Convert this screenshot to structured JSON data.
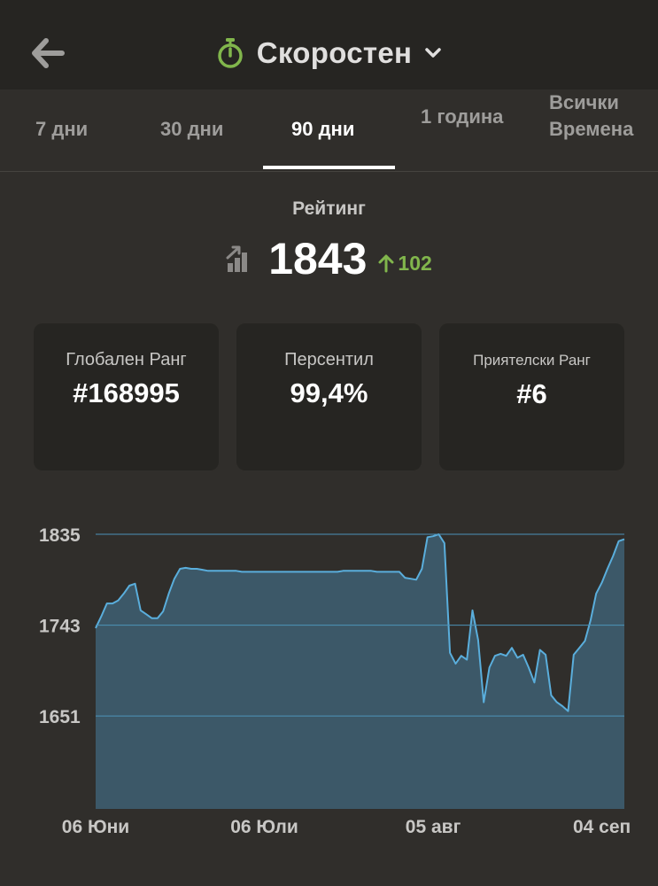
{
  "header": {
    "title": "Скоростен",
    "icons": {
      "back": "arrow-left-icon",
      "mode": "stopwatch-icon",
      "dropdown": "chevron-down-icon"
    },
    "mode_icon_color": "#81b64c"
  },
  "tabs": [
    {
      "label": "7 дни",
      "active": false
    },
    {
      "label": "30 дни",
      "active": false
    },
    {
      "label": "90 дни",
      "active": true
    },
    {
      "label": "1 година",
      "active": false
    },
    {
      "label": "Всички Времена",
      "active": false
    }
  ],
  "rating": {
    "label": "Рейтинг",
    "value": "1843",
    "delta": "102",
    "delta_direction": "up",
    "delta_color": "#81b64c",
    "icon": "rating-trend-icon"
  },
  "stats": [
    {
      "label": "Глобален Ранг",
      "value": "#168995"
    },
    {
      "label": "Персентил",
      "value": "99,4%"
    },
    {
      "label": "Приятелски Ранг",
      "value": "#6"
    }
  ],
  "chart_data": {
    "type": "area",
    "ylim": [
      1557,
      1835
    ],
    "yticks": [
      1835,
      1743,
      1651
    ],
    "xticks": [
      {
        "label": "06 Юни",
        "x": 0
      },
      {
        "label": "06 Юли",
        "x": 30
      },
      {
        "label": "05 авг",
        "x": 60
      },
      {
        "label": "04 сеп",
        "x": 90
      }
    ],
    "grid": true,
    "colors": {
      "line": "#5aaedc",
      "fill": "#3c5868",
      "grid": "#4c93b8"
    },
    "x": [
      0,
      1,
      2,
      3,
      4,
      5,
      6,
      7,
      8,
      9,
      10,
      11,
      12,
      13,
      14,
      15,
      16,
      17,
      18,
      19,
      20,
      21,
      22,
      23,
      24,
      25,
      26,
      27,
      28,
      29,
      30,
      31,
      32,
      33,
      34,
      35,
      36,
      37,
      38,
      39,
      40,
      41,
      42,
      43,
      44,
      45,
      46,
      47,
      48,
      49,
      50,
      51,
      52,
      53,
      54,
      55,
      56,
      57,
      58,
      59,
      60,
      61,
      62,
      63,
      64,
      65,
      66,
      67,
      68,
      69,
      70,
      71,
      72,
      73,
      74,
      75,
      76,
      77,
      78,
      79,
      80,
      81,
      82,
      83,
      84,
      85,
      86,
      87,
      88,
      89,
      90,
      91,
      92,
      93,
      94
    ],
    "values": [
      1740,
      1752,
      1765,
      1765,
      1768,
      1775,
      1783,
      1785,
      1758,
      1754,
      1750,
      1750,
      1757,
      1775,
      1790,
      1800,
      1801,
      1800,
      1800,
      1799,
      1798,
      1798,
      1798,
      1798,
      1798,
      1798,
      1797,
      1797,
      1797,
      1797,
      1797,
      1797,
      1797,
      1797,
      1797,
      1797,
      1797,
      1797,
      1797,
      1797,
      1797,
      1797,
      1797,
      1797,
      1798,
      1798,
      1798,
      1798,
      1798,
      1798,
      1797,
      1797,
      1797,
      1797,
      1797,
      1791,
      1790,
      1789,
      1800,
      1832,
      1833,
      1835,
      1826,
      1715,
      1704,
      1712,
      1708,
      1758,
      1728,
      1665,
      1700,
      1712,
      1714,
      1712,
      1720,
      1710,
      1713,
      1700,
      1685,
      1718,
      1713,
      1672,
      1665,
      1661,
      1656,
      1713,
      1720,
      1727,
      1748,
      1775,
      1786,
      1800,
      1813,
      1828,
      1830
    ]
  }
}
